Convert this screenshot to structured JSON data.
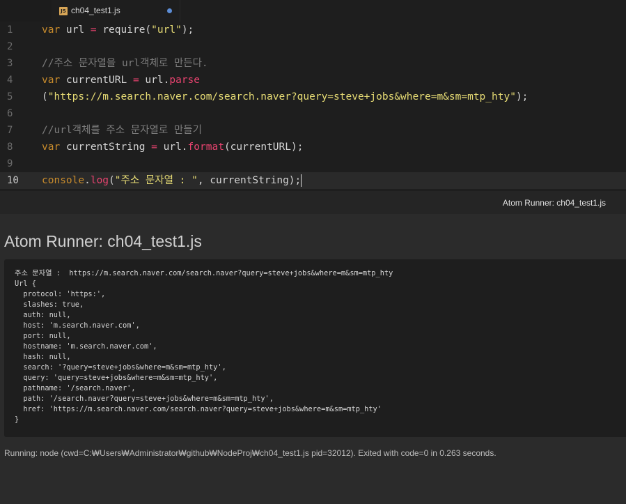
{
  "tab": {
    "icon_label": "JS",
    "title": "ch04_test1.js",
    "modified": true
  },
  "editor": {
    "lines": [
      {
        "num": "1",
        "tokens": [
          [
            "kw",
            "var"
          ],
          [
            "id",
            " url "
          ],
          [
            "op",
            "="
          ],
          [
            "id",
            " require("
          ],
          [
            "str",
            "\"url\""
          ],
          [
            "id",
            ");"
          ]
        ]
      },
      {
        "num": "2",
        "tokens": []
      },
      {
        "num": "3",
        "tokens": [
          [
            "cm",
            "//주소 문자열을 url객체로 만든다."
          ]
        ]
      },
      {
        "num": "4",
        "tokens": [
          [
            "kw",
            "var"
          ],
          [
            "id",
            " currentURL "
          ],
          [
            "op",
            "="
          ],
          [
            "id",
            " url."
          ],
          [
            "fn",
            "parse"
          ]
        ]
      },
      {
        "num": "5",
        "tokens": [
          [
            "id",
            "("
          ],
          [
            "str",
            "\"https://m.search.naver.com/search.naver?query=steve+jobs&where=m&sm=mtp_hty\""
          ],
          [
            "id",
            ");"
          ]
        ]
      },
      {
        "num": "6",
        "tokens": []
      },
      {
        "num": "7",
        "tokens": [
          [
            "cm",
            "//url객체를 주소 문자열로 만들기"
          ]
        ]
      },
      {
        "num": "8",
        "tokens": [
          [
            "kw",
            "var"
          ],
          [
            "id",
            " currentString "
          ],
          [
            "op",
            "="
          ],
          [
            "id",
            " url."
          ],
          [
            "fn",
            "format"
          ],
          [
            "id",
            "(currentURL);"
          ]
        ]
      },
      {
        "num": "9",
        "tokens": []
      },
      {
        "num": "10",
        "tokens": [
          [
            "kw",
            "console"
          ],
          [
            "id",
            "."
          ],
          [
            "fn",
            "log"
          ],
          [
            "id",
            "("
          ],
          [
            "str",
            "\"주소 문자열 : \""
          ],
          [
            "id",
            ", currentString);"
          ]
        ],
        "current": true
      }
    ]
  },
  "runner": {
    "bar_title": "Atom Runner: ch04_test1.js",
    "heading": "Atom Runner: ch04_test1.js",
    "output": "주소 문자열 :  https://m.search.naver.com/search.naver?query=steve+jobs&where=m&sm=mtp_hty\nUrl {\n  protocol: 'https:',\n  slashes: true,\n  auth: null,\n  host: 'm.search.naver.com',\n  port: null,\n  hostname: 'm.search.naver.com',\n  hash: null,\n  search: '?query=steve+jobs&where=m&sm=mtp_hty',\n  query: 'query=steve+jobs&where=m&sm=mtp_hty',\n  pathname: '/search.naver',\n  path: '/search.naver?query=steve+jobs&where=m&sm=mtp_hty',\n  href: 'https://m.search.naver.com/search.naver?query=steve+jobs&where=m&sm=mtp_hty'\n}",
    "status": "Running: node (cwd=C:₩Users₩Administrator₩github₩NodeProj₩ch04_test1.js pid=32012). Exited with code=0 in 0.263 seconds."
  },
  "colors": {
    "keyword": "#c98c2c",
    "operator": "#e8436f",
    "string": "#e6db74",
    "comment": "#7c7c7c",
    "modified_dot": "#5c8dd6"
  }
}
